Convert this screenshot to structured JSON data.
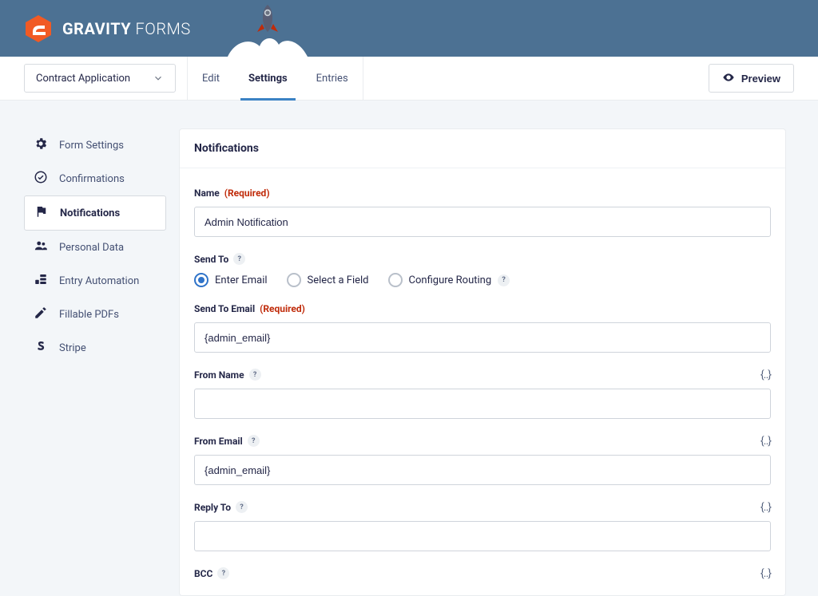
{
  "brand": {
    "bold": "GRAVITY",
    "light": " FORMS"
  },
  "form_selector": {
    "selected": "Contract Application"
  },
  "tabs": {
    "edit": "Edit",
    "settings": "Settings",
    "entries": "Entries"
  },
  "preview_label": "Preview",
  "sidebar": {
    "items": [
      {
        "label": "Form Settings"
      },
      {
        "label": "Confirmations"
      },
      {
        "label": "Notifications"
      },
      {
        "label": "Personal Data"
      },
      {
        "label": "Entry Automation"
      },
      {
        "label": "Fillable PDFs"
      },
      {
        "label": "Stripe"
      }
    ]
  },
  "panel": {
    "title": "Notifications"
  },
  "fields": {
    "name": {
      "label": "Name",
      "required": "(Required)",
      "value": "Admin Notification"
    },
    "send_to": {
      "label": "Send To",
      "opts": {
        "enter_email": "Enter Email",
        "select_field": "Select a Field",
        "configure_routing": "Configure Routing"
      }
    },
    "send_to_email": {
      "label": "Send To Email",
      "required": "(Required)",
      "value": "{admin_email}"
    },
    "from_name": {
      "label": "From Name",
      "value": ""
    },
    "from_email": {
      "label": "From Email",
      "value": "{admin_email}"
    },
    "reply_to": {
      "label": "Reply To",
      "value": ""
    },
    "bcc": {
      "label": "BCC"
    }
  },
  "merge_tag_glyph": "{‥}"
}
